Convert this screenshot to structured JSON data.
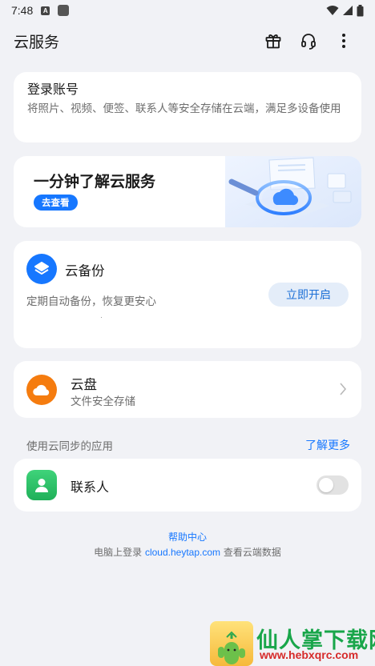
{
  "status_bar": {
    "time": "7:48",
    "badge": "A"
  },
  "app_bar": {
    "title": "云服务",
    "icons": [
      "gift-icon",
      "headset-icon",
      "more-vert-icon"
    ]
  },
  "login_card": {
    "title": "登录账号",
    "description": "将照片、视频、便签、联系人等安全存储在云端，满足多设备使用"
  },
  "banner": {
    "title": "一分钟了解云服务",
    "button_label": "去查看"
  },
  "backup_card": {
    "title": "云备份",
    "description": "定期自动备份，恢复更安心",
    "button_label": "立即开启"
  },
  "disk_card": {
    "title": "云盘",
    "description": "文件安全存储"
  },
  "sync_section": {
    "label": "使用云同步的应用",
    "link_label": "了解更多"
  },
  "apps": [
    {
      "name": "联系人",
      "enabled": false
    }
  ],
  "footer": {
    "help_label": "帮助中心",
    "prefix": "电脑上登录",
    "url": "cloud.heytap.com",
    "suffix": "查看云端数据"
  },
  "watermark": {
    "text": "仙人掌下载网",
    "url": "www.hebxqrc.com"
  },
  "colors": {
    "accent": "#1677ff",
    "background": "#f1f2f6",
    "disk_icon": "#f57c0f",
    "contacts_icon": "#2cc366"
  }
}
